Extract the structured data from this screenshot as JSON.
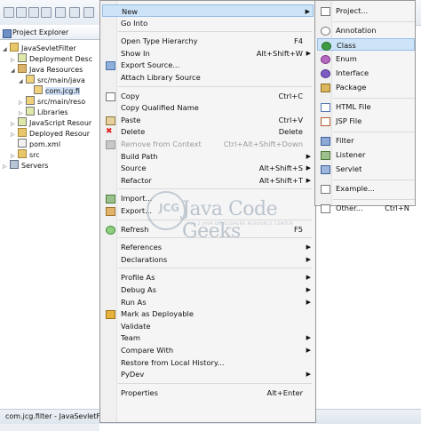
{
  "project_explorer": {
    "tab_label": "Project Explorer",
    "tree": [
      {
        "label": "JavaSevletFilter",
        "indent": 1,
        "icon": "project-icon",
        "expanded": true
      },
      {
        "label": "Deployment Desc",
        "indent": 2,
        "icon": "deployment-descriptor-icon",
        "expanded": false
      },
      {
        "label": "Java Resources",
        "indent": 2,
        "icon": "java-resources-icon",
        "expanded": true
      },
      {
        "label": "src/main/java",
        "indent": 3,
        "icon": "source-folder-icon",
        "expanded": true
      },
      {
        "label": "com.jcg.fi",
        "indent": 4,
        "icon": "package-icon",
        "selected": true
      },
      {
        "label": "src/main/reso",
        "indent": 3,
        "icon": "source-folder-icon",
        "expanded": false
      },
      {
        "label": "Libraries",
        "indent": 3,
        "icon": "libraries-icon",
        "expanded": false
      },
      {
        "label": "JavaScript Resour",
        "indent": 2,
        "icon": "javascript-resources-icon",
        "expanded": false
      },
      {
        "label": "Deployed Resour",
        "indent": 2,
        "icon": "deployed-resources-icon",
        "expanded": false
      },
      {
        "label": "pom.xml",
        "indent": 2,
        "icon": "xml-file-icon"
      },
      {
        "label": "src",
        "indent": 2,
        "icon": "folder-icon",
        "expanded": false
      },
      {
        "label": "Servers",
        "indent": 1,
        "icon": "servers-icon",
        "expanded": false
      }
    ]
  },
  "status_bar": {
    "text": "com.jcg.filter - JavaSevletFilt"
  },
  "context_menu": {
    "items": [
      {
        "label": "New",
        "shortcut": "",
        "submenu": true,
        "highlighted": true
      },
      {
        "label": "Go Into",
        "shortcut": ""
      },
      {
        "separator": true
      },
      {
        "label": "Open Type Hierarchy",
        "shortcut": "F4"
      },
      {
        "label": "Show In",
        "shortcut": "Alt+Shift+W",
        "submenu": true
      },
      {
        "label": "Export Source...",
        "shortcut": "",
        "icon": "export-source-icon"
      },
      {
        "label": "Attach Library Source",
        "shortcut": ""
      },
      {
        "separator": true
      },
      {
        "label": "Copy",
        "shortcut": "Ctrl+C",
        "icon": "copy-icon"
      },
      {
        "label": "Copy Qualified Name",
        "shortcut": ""
      },
      {
        "label": "Paste",
        "shortcut": "Ctrl+V",
        "icon": "paste-icon"
      },
      {
        "label": "Delete",
        "shortcut": "Delete",
        "icon": "delete-icon"
      },
      {
        "label": "Remove from Context",
        "shortcut": "Ctrl+Alt+Shift+Down",
        "disabled": true,
        "icon": "remove-context-icon"
      },
      {
        "label": "Build Path",
        "shortcut": "",
        "submenu": true
      },
      {
        "label": "Source",
        "shortcut": "Alt+Shift+S",
        "submenu": true
      },
      {
        "label": "Refactor",
        "shortcut": "Alt+Shift+T",
        "submenu": true
      },
      {
        "separator": true
      },
      {
        "label": "Import...",
        "shortcut": "",
        "icon": "import-icon"
      },
      {
        "label": "Export...",
        "shortcut": "",
        "icon": "export-icon"
      },
      {
        "separator": true
      },
      {
        "label": "Refresh",
        "shortcut": "F5",
        "icon": "refresh-icon"
      },
      {
        "separator": true
      },
      {
        "label": "References",
        "shortcut": "",
        "submenu": true
      },
      {
        "label": "Declarations",
        "shortcut": "",
        "submenu": true
      },
      {
        "separator": true
      },
      {
        "label": "Profile As",
        "shortcut": "",
        "submenu": true
      },
      {
        "label": "Debug As",
        "shortcut": "",
        "submenu": true
      },
      {
        "label": "Run As",
        "shortcut": "",
        "submenu": true
      },
      {
        "label": "Mark as Deployable",
        "shortcut": "",
        "icon": "deployable-icon"
      },
      {
        "label": "Validate",
        "shortcut": ""
      },
      {
        "label": "Team",
        "shortcut": "",
        "submenu": true
      },
      {
        "label": "Compare With",
        "shortcut": "",
        "submenu": true
      },
      {
        "label": "Restore from Local History...",
        "shortcut": ""
      },
      {
        "label": "PyDev",
        "shortcut": "",
        "submenu": true
      },
      {
        "separator": true
      },
      {
        "label": "Properties",
        "shortcut": "Alt+Enter"
      }
    ]
  },
  "new_submenu": {
    "items": [
      {
        "label": "Project...",
        "shortcut": "",
        "icon": "project-wizard-icon"
      },
      {
        "separator": true
      },
      {
        "label": "Annotation",
        "shortcut": "",
        "icon": "annotation-icon"
      },
      {
        "label": "Class",
        "shortcut": "",
        "icon": "class-icon",
        "highlighted": true
      },
      {
        "label": "Enum",
        "shortcut": "",
        "icon": "enum-icon"
      },
      {
        "label": "Interface",
        "shortcut": "",
        "icon": "interface-icon"
      },
      {
        "label": "Package",
        "shortcut": "",
        "icon": "package-icon"
      },
      {
        "separator": true
      },
      {
        "label": "HTML File",
        "shortcut": "",
        "icon": "html-file-icon"
      },
      {
        "label": "JSP File",
        "shortcut": "",
        "icon": "jsp-file-icon"
      },
      {
        "separator": true
      },
      {
        "label": "Filter",
        "shortcut": "",
        "icon": "filter-icon"
      },
      {
        "label": "Listener",
        "shortcut": "",
        "icon": "listener-icon"
      },
      {
        "label": "Servlet",
        "shortcut": "",
        "icon": "servlet-icon"
      },
      {
        "separator": true
      },
      {
        "label": "Example...",
        "shortcut": "",
        "icon": "example-icon"
      },
      {
        "separator": true
      },
      {
        "label": "Other...",
        "shortcut": "Ctrl+N",
        "icon": "other-wizard-icon"
      }
    ]
  },
  "watermark": {
    "title": "Java Code Geeks",
    "tagline": "JAVA 2 JAVA DEVELOPERS RESOURCE CENTER",
    "logo_text": "JCG"
  },
  "colors": {
    "highlight": "#cde3f7",
    "highlight_border": "#94bde6",
    "menu_bg": "#f5f5f5",
    "disabled_text": "#9a9a9a"
  }
}
